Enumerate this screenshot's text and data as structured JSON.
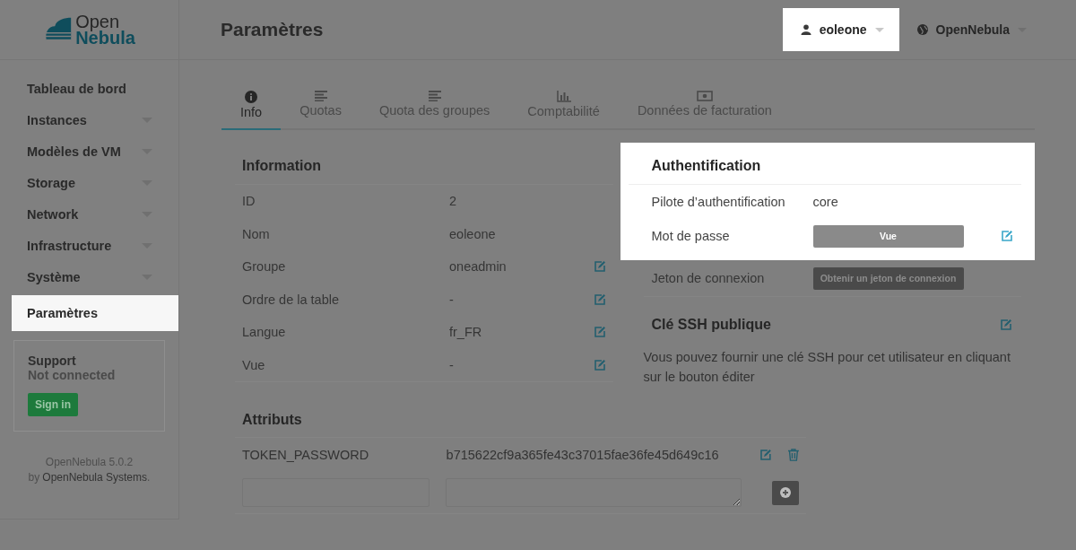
{
  "logo": {
    "line1": "Open",
    "line2": "Nebula"
  },
  "sidebar": {
    "items": [
      {
        "label": "Tableau de bord",
        "expandable": false,
        "selected": false
      },
      {
        "label": "Instances",
        "expandable": true,
        "selected": false
      },
      {
        "label": "Modèles de VM",
        "expandable": true,
        "selected": false
      },
      {
        "label": "Storage",
        "expandable": true,
        "selected": false
      },
      {
        "label": "Network",
        "expandable": true,
        "selected": false
      },
      {
        "label": "Infrastructure",
        "expandable": true,
        "selected": false
      },
      {
        "label": "Système",
        "expandable": true,
        "selected": false
      },
      {
        "label": "Paramètres",
        "expandable": false,
        "selected": true
      }
    ],
    "support": {
      "title": "Support",
      "status": "Not connected",
      "button": "Sign in"
    },
    "footer": {
      "version": "OpenNebula 5.0.2",
      "by": "by",
      "link": "OpenNebula Systems",
      "suffix": "."
    }
  },
  "header": {
    "title": "Paramètres",
    "user_menu": {
      "label": "eoleone",
      "highlighted": true
    },
    "zone_menu": {
      "label": "OpenNebula",
      "highlighted": false
    }
  },
  "tabs": [
    {
      "label": "Info",
      "selected": true
    },
    {
      "label": "Quotas",
      "selected": false
    },
    {
      "label": "Quota des groupes",
      "selected": false
    },
    {
      "label": "Comptabilité",
      "selected": false
    },
    {
      "label": "Données de facturation",
      "selected": false
    }
  ],
  "information": {
    "title": "Information",
    "rows": [
      {
        "label": "ID",
        "value": "2",
        "editable": false
      },
      {
        "label": "Nom",
        "value": "eoleone",
        "editable": false
      },
      {
        "label": "Groupe",
        "value": "oneadmin",
        "editable": true
      },
      {
        "label": "Ordre de la table",
        "value": "-",
        "editable": true
      },
      {
        "label": "Langue",
        "value": "fr_FR",
        "editable": true
      },
      {
        "label": "Vue",
        "value": "-",
        "editable": true
      }
    ]
  },
  "authentication": {
    "title": "Authentification",
    "highlighted": true,
    "driver_label": "Pilote d’authentification",
    "driver_value": "core",
    "password_label": "Mot de passe",
    "password_button": "Vue",
    "token_label": "Jeton de connexion",
    "token_button": "Obtenir un jeton de connexion"
  },
  "ssh": {
    "title": "Clé SSH publique",
    "text": "Vous pouvez fournir une clé SSH pour cet utilisateur en cliquant sur le bouton éditer"
  },
  "attributes": {
    "title": "Attributs",
    "rows": [
      {
        "name": "TOKEN_PASSWORD",
        "value": "b715622cf9a365fe43c37015fae36fe45d649c16"
      }
    ]
  }
}
